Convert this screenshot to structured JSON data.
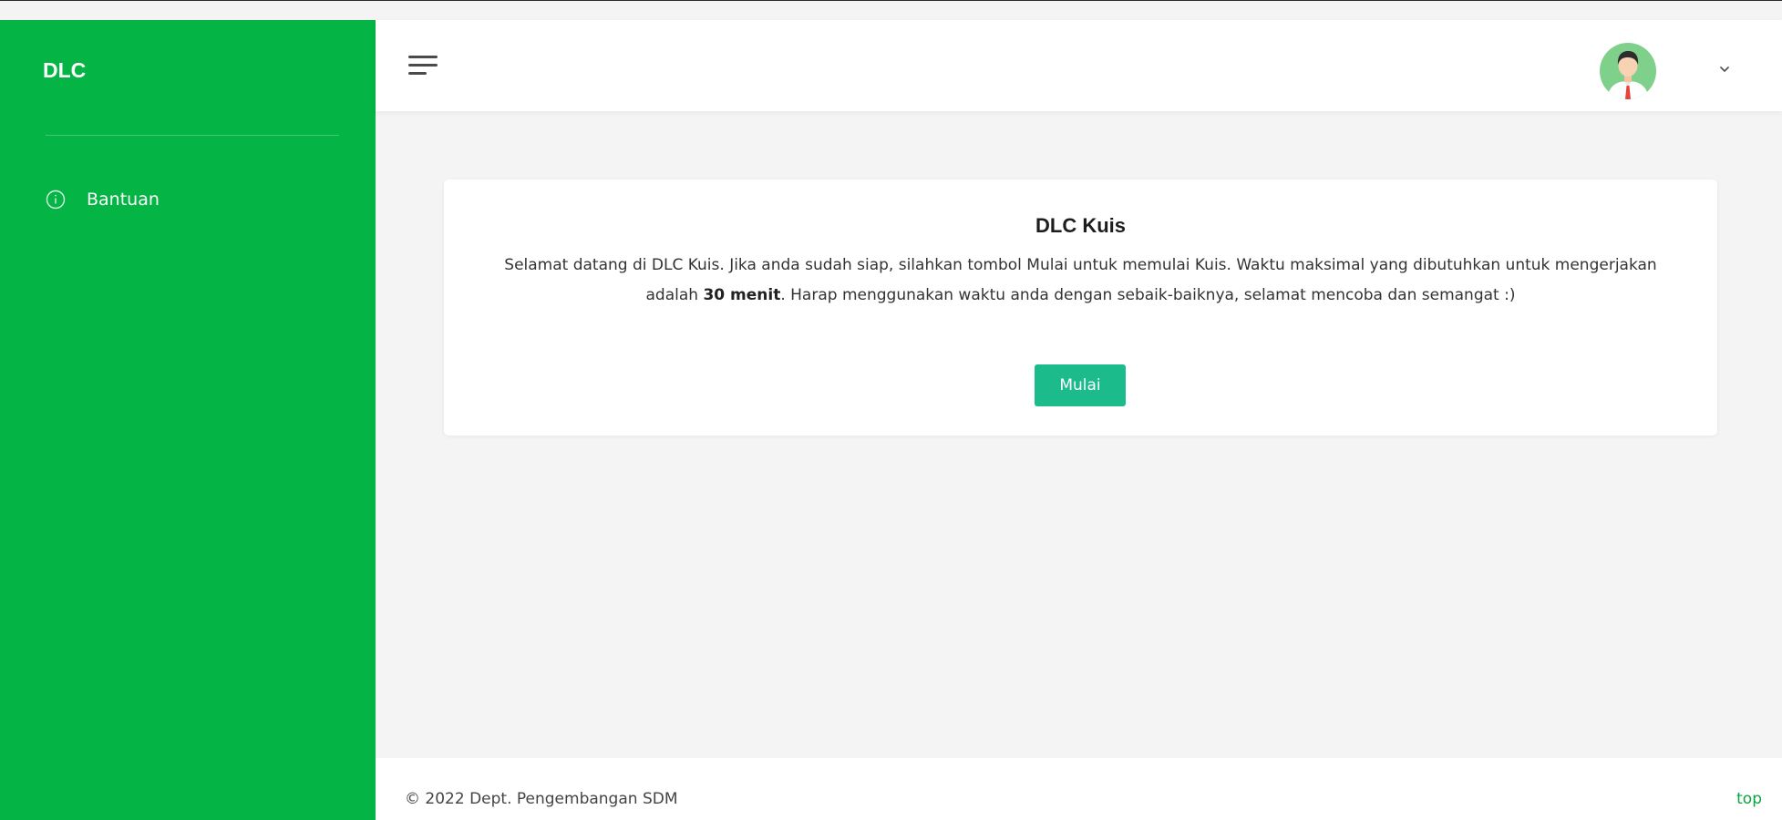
{
  "sidebar": {
    "brand": "DLC",
    "items": [
      {
        "label": "Bantuan",
        "icon": "info-circle-icon"
      }
    ]
  },
  "topbar": {
    "menu_icon": "hamburger-menu-icon",
    "user_icon": "user-avatar-icon",
    "dropdown_icon": "chevron-down-icon"
  },
  "card": {
    "title": "DLC Kuis",
    "text_before": "Selamat datang di DLC Kuis. Jika anda sudah siap, silahkan tombol Mulai untuk memulai Kuis. Waktu maksimal yang dibutuhkan untuk mengerjakan adalah ",
    "text_bold": "30 menit",
    "text_after": ". Harap menggunakan waktu anda dengan sebaik-baiknya, selamat mencoba dan semangat :)",
    "button_label": "Mulai"
  },
  "footer": {
    "copyright": "© 2022 Dept. Pengembangan SDM",
    "top_link": "top"
  },
  "colors": {
    "sidebar": "#04b445",
    "button": "#1cbb8c",
    "top_link": "#07a542",
    "background": "#f4f4f4"
  }
}
